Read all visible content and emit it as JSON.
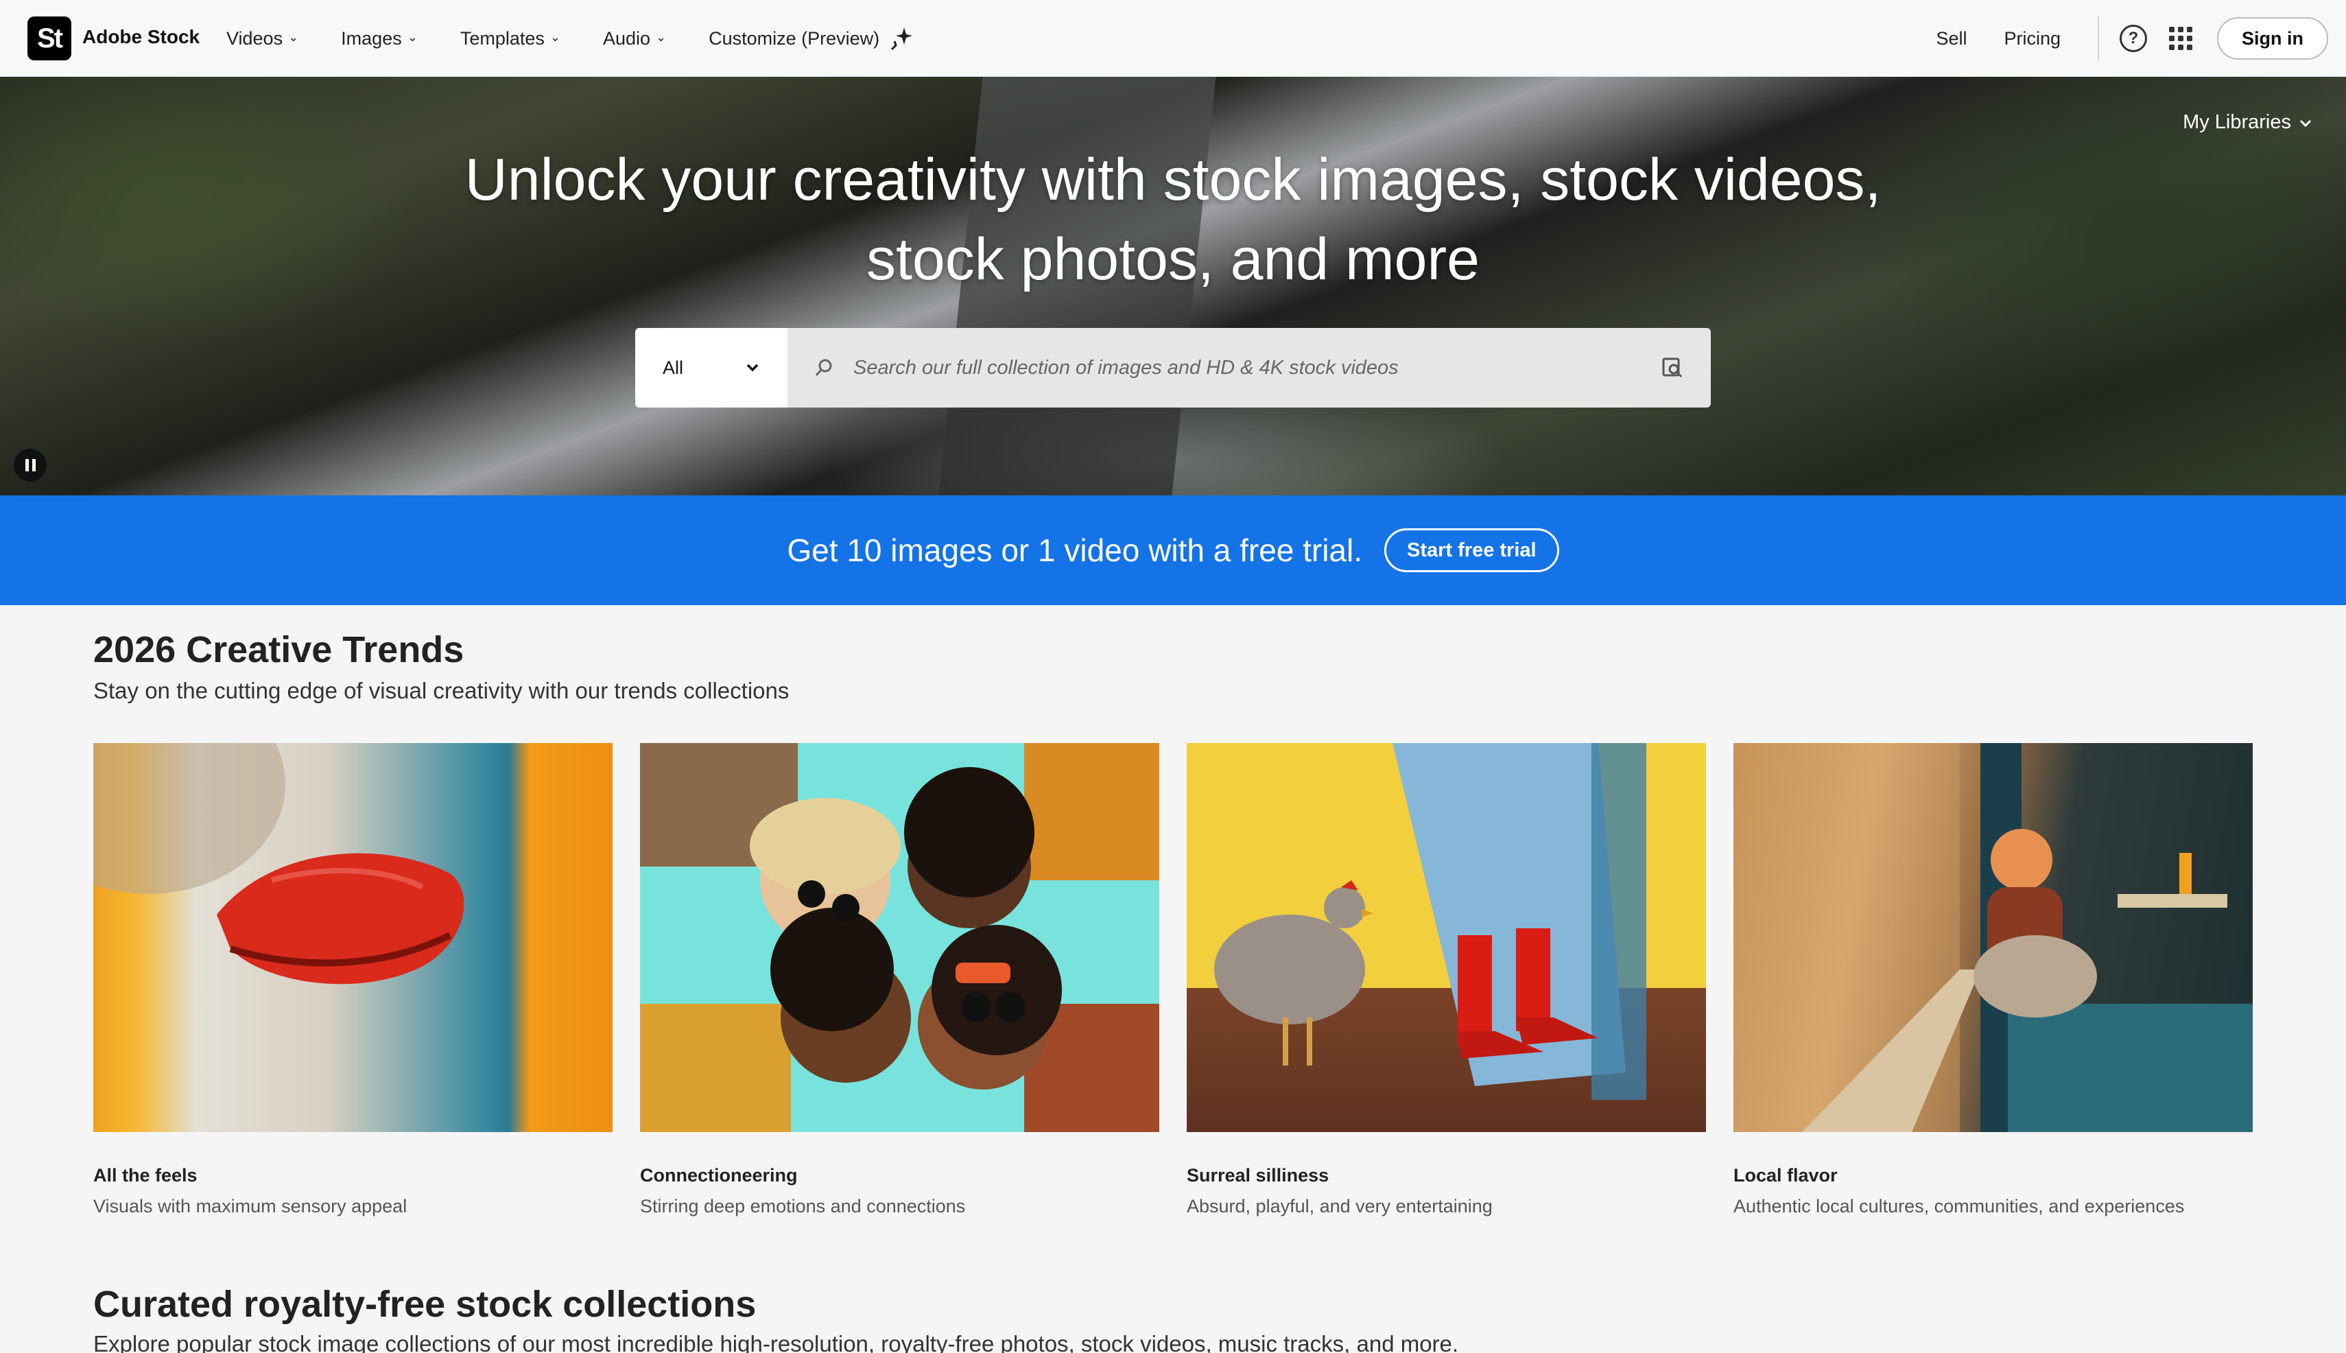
{
  "header": {
    "logo_mark": "St",
    "brand": "Adobe Stock",
    "nav": [
      {
        "label": "Videos"
      },
      {
        "label": "Images"
      },
      {
        "label": "Templates"
      },
      {
        "label": "Audio"
      },
      {
        "label": "Customize (Preview)"
      }
    ],
    "sell": "Sell",
    "pricing": "Pricing",
    "sign_in": "Sign in"
  },
  "hero": {
    "my_libraries": "My Libraries",
    "title_line1": "Unlock your creativity with stock images, stock videos,",
    "title_line2": "stock photos, and more",
    "search": {
      "category": "All",
      "placeholder": "Search our full collection of images and HD & 4K stock videos"
    }
  },
  "promo": {
    "text": "Get 10 images or 1 video with a free trial.",
    "button": "Start free trial"
  },
  "trends": {
    "title": "2026 Creative Trends",
    "subtitle": "Stay on the cutting edge of visual creativity with our trends collections",
    "cards": [
      {
        "title": "All the feels",
        "desc": "Visuals with maximum sensory appeal"
      },
      {
        "title": "Connectioneering",
        "desc": "Stirring deep emotions and connections"
      },
      {
        "title": "Surreal silliness",
        "desc": "Absurd, playful, and very entertaining"
      },
      {
        "title": "Local flavor",
        "desc": "Authentic local cultures, communities, and experiences"
      }
    ]
  },
  "collections": {
    "title": "Curated royalty-free stock collections",
    "subtitle": "Explore popular stock image collections of our most incredible high-resolution, royalty-free photos, stock videos, music tracks, and more."
  },
  "colors": {
    "promo_blue": "#1473e6",
    "header_bg": "#f8f8f8"
  }
}
